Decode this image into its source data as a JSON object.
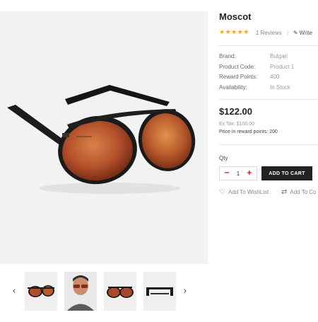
{
  "product": {
    "title": "Moscot",
    "stars": "★★★★★",
    "reviews": "1 Reviews",
    "separator": "|",
    "write_review": "Write",
    "meta": [
      {
        "label": "Brand:",
        "value": "Bulgari"
      },
      {
        "label": "Product Code:",
        "value": "Product 1"
      },
      {
        "label": "Reward Points:",
        "value": "400"
      },
      {
        "label": "Availability:",
        "value": "In Stock"
      }
    ],
    "price": "$122.00",
    "ex_tax": "Ex Tax: $100.00",
    "reward_price": "Price in reward points: 200",
    "qty_label": "Qty",
    "qty_value": "1",
    "qty_minus": "−",
    "qty_plus": "+",
    "add_to_cart": "ADD TO CART",
    "wishlist": "Add To WishList",
    "compare": "Add To Co"
  },
  "thumbnails": {
    "prev": "‹",
    "next": "›"
  },
  "colors": {
    "star": "#f5a623",
    "qty_accent": "#cc0000",
    "cart_bg": "#222222",
    "image_bg": "#f2f2f2"
  },
  "icons": [
    "star-icon",
    "pencil-icon",
    "minus-icon",
    "plus-icon",
    "heart-icon",
    "compare-icon",
    "chevron-left-icon",
    "chevron-right-icon"
  ]
}
